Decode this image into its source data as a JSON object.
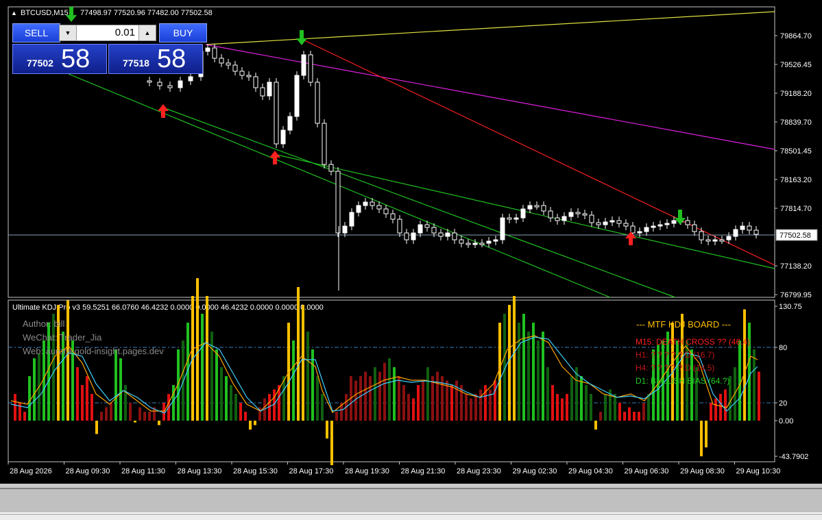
{
  "header": {
    "symbol_label": "BTCUSD,M15",
    "ohlc": "77498.97 77520.96 77482.00 77502.58"
  },
  "trade_panel": {
    "sell_label": "SELL",
    "buy_label": "BUY",
    "lot": "0.01",
    "sell_price_main": "77502",
    "sell_price_big": "58",
    "buy_price_main": "77518",
    "buy_price_big": "58"
  },
  "price_axis": {
    "ticks": [
      "79864.70",
      "79526.45",
      "79188.20",
      "78839.70",
      "78501.45",
      "78163.20",
      "77814.70",
      "77138.20",
      "76799.95"
    ],
    "current_price": "77502.58"
  },
  "indicator": {
    "title": "Ultimate KDJ Pro v3 59.5251 66.0760 46.4232 0.0000 0.0000 46.4232 0.0000 0.0000 0.0000",
    "author": "Author: bill",
    "wechat": "WeChat: Trader_Jia",
    "web": "Web: aurora-gold-insight.pages.dev",
    "axis_ticks": [
      "130.75",
      "80",
      "20",
      "0.00",
      "-43.7902"
    ],
    "board": {
      "title": "--- MTF KDJ BOARD ---",
      "lines": [
        {
          "text": "M15: DEATH CROSS ?? (46.4)",
          "color": "#ff2020"
        },
        {
          "text": "H1: ? ? ? ? ? D (16.7)",
          "color": "#c01818"
        },
        {
          "text": "H4: ? ? ? ? ? D (14.5)",
          "color": "#c01818"
        },
        {
          "text": "D1: BULLISH BIAS (64.?)",
          "color": "#22cc22"
        }
      ]
    }
  },
  "time_axis": [
    "28 Aug 2026",
    "28 Aug 09:30",
    "28 Aug 11:30",
    "28 Aug 13:30",
    "28 Aug 15:30",
    "28 Aug 17:30",
    "28 Aug 19:30",
    "28 Aug 21:30",
    "28 Aug 23:30",
    "29 Aug 02:30",
    "29 Aug 04:30",
    "29 Aug 06:30",
    "29 Aug 08:30",
    "29 Aug 10:30"
  ],
  "colors": {
    "background": "#000000",
    "candle": "#ffffff",
    "trend_green": "#20c020",
    "trend_red": "#ff2020",
    "trend_magenta": "#e020e0",
    "trend_yellow": "#e0e040",
    "arrow_up": "#ff2020",
    "arrow_down": "#20c020",
    "k_line": "#ffa500",
    "d_line": "#40d0ff",
    "hist_gold": "#ffc000",
    "hist_green": "#20c020",
    "hist_darkgreen": "#106010",
    "hist_red": "#e01010",
    "hist_darkred": "#8a1010"
  }
}
